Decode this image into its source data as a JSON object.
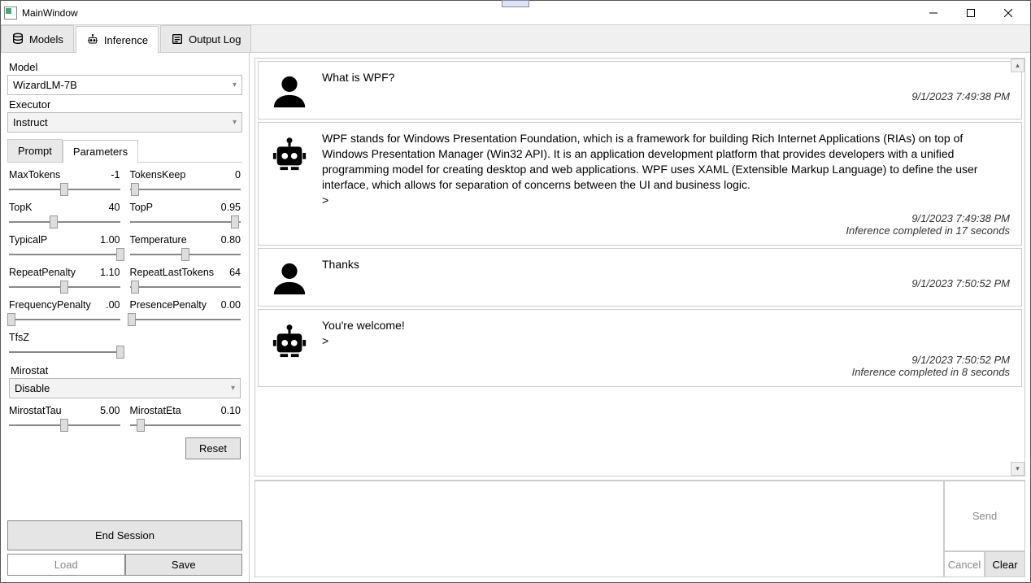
{
  "window": {
    "title": "MainWindow"
  },
  "tabs": {
    "models": "Models",
    "inference": "Inference",
    "output_log": "Output Log"
  },
  "model": {
    "label": "Model",
    "value": "WizardLM-7B"
  },
  "executor": {
    "label": "Executor",
    "value": "Instruct"
  },
  "subtabs": {
    "prompt": "Prompt",
    "parameters": "Parameters"
  },
  "params": {
    "maxTokens": {
      "label": "MaxTokens",
      "value": "-1",
      "pos": 50
    },
    "tokensKeep": {
      "label": "TokensKeep",
      "value": "0",
      "pos": 5
    },
    "topK": {
      "label": "TopK",
      "value": "40",
      "pos": 40
    },
    "topP": {
      "label": "TopP",
      "value": "0.95",
      "pos": 95
    },
    "typicalP": {
      "label": "TypicalP",
      "value": "1.00",
      "pos": 100
    },
    "temperature": {
      "label": "Temperature",
      "value": "0.80",
      "pos": 50
    },
    "repeatPenalty": {
      "label": "RepeatPenalty",
      "value": "1.10",
      "pos": 50
    },
    "repeatLastTokens": {
      "label": "RepeatLastTokens",
      "value": "64",
      "pos": 5
    },
    "frequencyPenalty": {
      "label": "FrequencyPenalty",
      "value": ".00",
      "pos": 2
    },
    "presencePenalty": {
      "label": "PresencePenalty",
      "value": "0.00",
      "pos": 2
    },
    "tfsZ": {
      "label": "TfsZ",
      "value": "",
      "pos": 100
    },
    "mirostat": {
      "label": "Mirostat",
      "value": "Disable"
    },
    "mirostatTau": {
      "label": "MirostatTau",
      "value": "5.00",
      "pos": 50
    },
    "mirostatEta": {
      "label": "MirostatEta",
      "value": "0.10",
      "pos": 10
    }
  },
  "buttons": {
    "reset": "Reset",
    "endSession": "End Session",
    "load": "Load",
    "save": "Save",
    "send": "Send",
    "cancel": "Cancel",
    "clear": "Clear"
  },
  "messages": [
    {
      "role": "user",
      "text": "What is WPF?",
      "time": "9/1/2023 7:49:38 PM",
      "extra": ""
    },
    {
      "role": "bot",
      "text": "WPF stands for Windows Presentation Foundation, which is a framework for building Rich Internet Applications (RIAs) on top of Windows Presentation Manager (Win32 API). It is an application development platform that provides developers with a unified programming model for creating desktop and web applications. WPF uses XAML (Extensible Markup Language) to define the user interface, which allows for separation of concerns between the UI and business logic.\n>",
      "time": "9/1/2023 7:49:38 PM",
      "extra": "Inference completed in 17 seconds"
    },
    {
      "role": "user",
      "text": "Thanks",
      "time": "9/1/2023 7:50:52 PM",
      "extra": ""
    },
    {
      "role": "bot",
      "text": "You're welcome!\n>",
      "time": "9/1/2023 7:50:52 PM",
      "extra": "Inference completed in 8 seconds"
    }
  ]
}
